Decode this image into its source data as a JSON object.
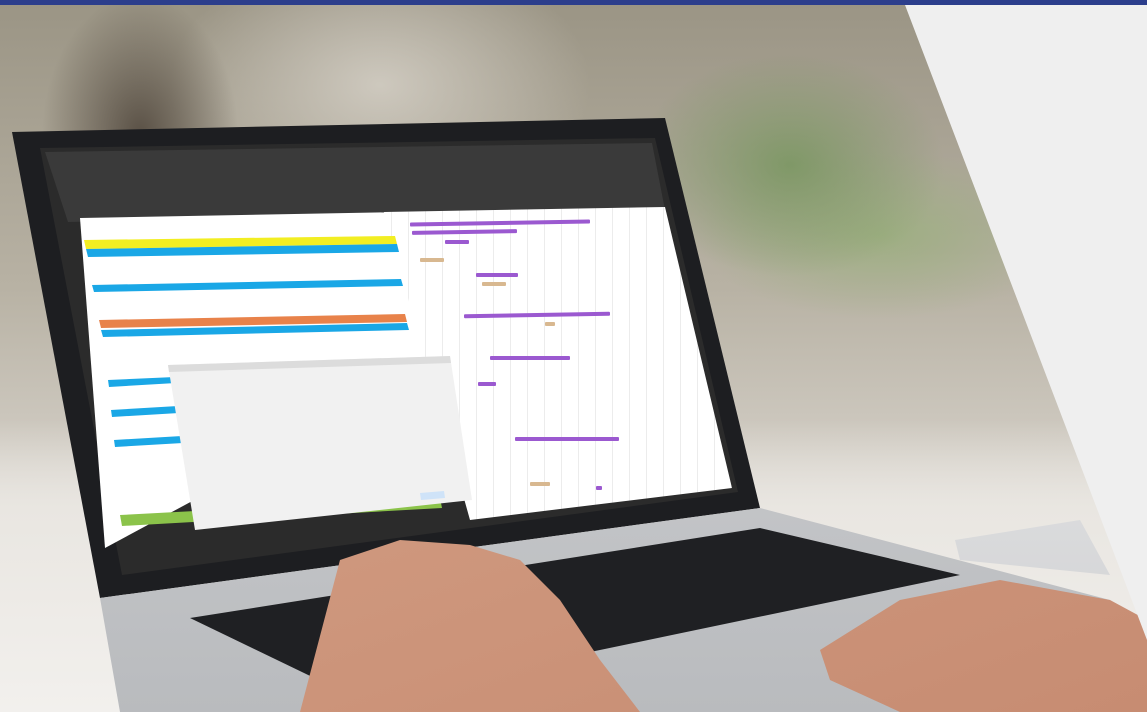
{
  "image": {
    "subject": "",
    "colors": {
      "accent_strip": "#2c3e8c",
      "right_panel": "#efefef",
      "gantt_bar": "#9b59d0",
      "row_highlight_blue": "#1aa7e6",
      "row_highlight_yellow": "#f2ee22",
      "row_highlight_orange": "#e8824a",
      "row_highlight_green": "#8bc34a"
    }
  }
}
